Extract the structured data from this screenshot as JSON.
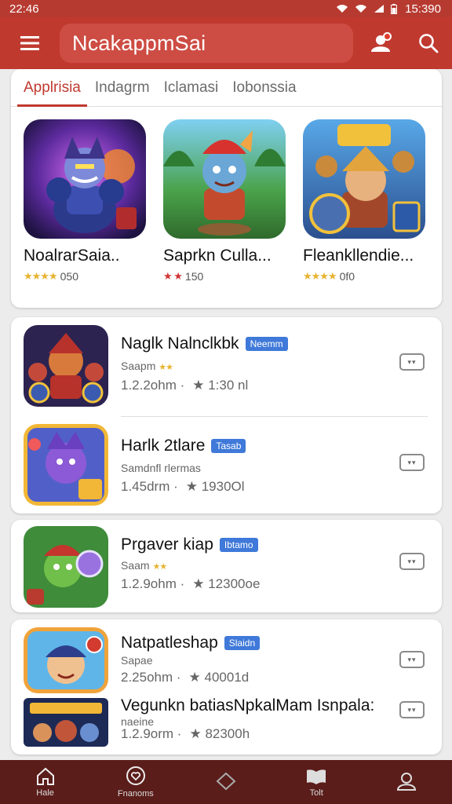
{
  "status": {
    "time_left": "22:46",
    "time_right": "15:390"
  },
  "topbar": {
    "title": "NcakappmSai"
  },
  "tabs": [
    "Applrisia",
    "Indagrm",
    "Iclamasi",
    "Iobonssia"
  ],
  "featured": [
    {
      "name": "NoalrarSaia..",
      "rating": "050",
      "stars": "★★★★"
    },
    {
      "name": "Saprkn Culla...",
      "rating": "150",
      "stars": "★ ★"
    },
    {
      "name": "Fleankllendie...",
      "rating": "0f0",
      "stars": "★★★★"
    }
  ],
  "list": [
    {
      "title": "Naglk Nalnclkbk",
      "badge": "Neemm",
      "sub": "Saapm",
      "size": "1.2.2ohm ·",
      "rating": "★ 1:30 nl"
    },
    {
      "title": "Harlk 2tlare",
      "badge": "Tasab",
      "sub": "Samdnfl rlermas",
      "size": "1.45drm ·",
      "rating": "★ 1930Ol"
    },
    {
      "title": "Prgaver kiap",
      "badge": "Ibtamo",
      "sub": "Saam",
      "size": "1.2.9ohm ·",
      "rating": "★ 12300oe"
    },
    {
      "title": "Natpatleshap",
      "badge": "Slaidn",
      "sub": "Sapae",
      "size": "2.25ohm ·",
      "rating": "★ 40001d"
    },
    {
      "title": "Vegunkn batiasNpkalMam Isnpala:",
      "badge": "",
      "sub": "naeine",
      "size": "1.2.9orm ·",
      "rating": "★ 82300h"
    }
  ],
  "list_button": "▾▾",
  "nav": [
    {
      "label": "Hale",
      "icon": "home-icon"
    },
    {
      "label": "Fnanoms",
      "icon": "heart-icon"
    },
    {
      "label": "",
      "icon": "chat-icon"
    },
    {
      "label": "Tolt",
      "icon": "book-icon"
    },
    {
      "label": "",
      "icon": "profile-icon"
    }
  ],
  "colors": {
    "primary": "#c0392f",
    "nav_bg": "#5a1d1a",
    "badge": "#3f79d9",
    "star": "#e7b431"
  }
}
